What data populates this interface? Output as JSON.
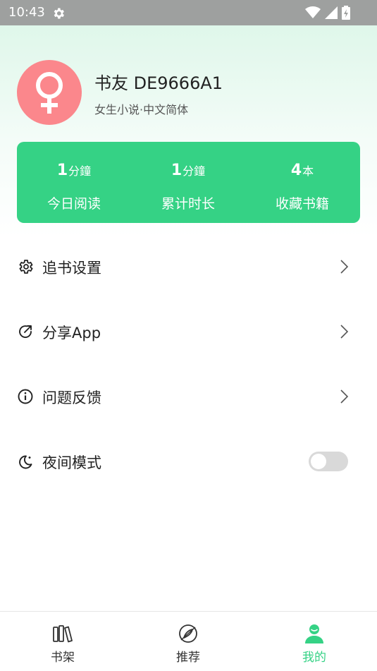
{
  "status_bar": {
    "time": "10:43",
    "icons": [
      "settings-gear-icon",
      "wifi-icon",
      "signal-icon",
      "battery-icon"
    ]
  },
  "profile": {
    "username": "书友 DE9666A1",
    "subtitle": "女生小说·中文简体",
    "avatar_icon": "female-symbol-icon",
    "avatar_color": "#fb878c"
  },
  "stats": [
    {
      "value": "1",
      "unit": "分鐘",
      "label": "今日阅读"
    },
    {
      "value": "1",
      "unit": "分鐘",
      "label": "累计时长"
    },
    {
      "value": "4",
      "unit": "本",
      "label": "收藏书籍"
    }
  ],
  "menu": [
    {
      "label": "追书设置",
      "icon": "gear-icon"
    },
    {
      "label": "分享App",
      "icon": "share-icon"
    },
    {
      "label": "问题反馈",
      "icon": "info-icon"
    },
    {
      "label": "夜间模式",
      "icon": "moon-icon",
      "toggle_on": false
    }
  ],
  "bottom_nav": [
    {
      "label": "书架",
      "icon": "bookshelf-icon",
      "active": false
    },
    {
      "label": "推荐",
      "icon": "recommend-icon",
      "active": false
    },
    {
      "label": "我的",
      "icon": "profile-icon",
      "active": true
    }
  ],
  "colors": {
    "accent": "#35d285",
    "avatar_bg": "#fb878c",
    "status_bar": "#9ea09f"
  }
}
